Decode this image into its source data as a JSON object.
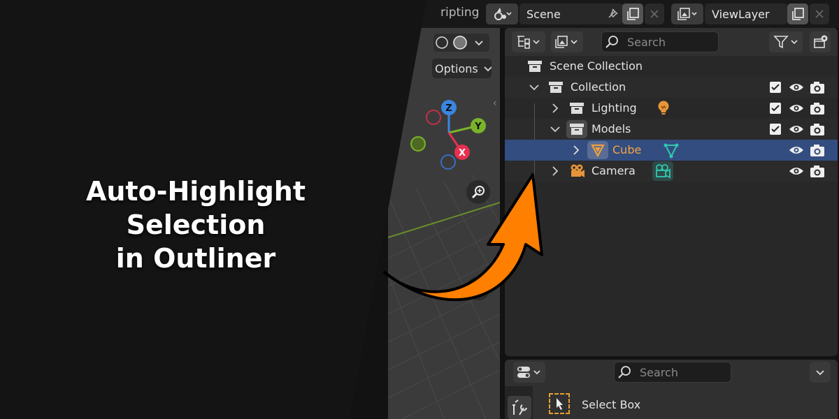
{
  "topbar": {
    "workspace_tab": "ripting",
    "scene_label": "Scene",
    "viewlayer_label": "ViewLayer"
  },
  "viewport": {
    "options_label": "Options",
    "gizmo": {
      "z": "Z",
      "y": "Y",
      "x": "X"
    }
  },
  "outliner": {
    "search_placeholder": "Search",
    "rows": [
      {
        "label": "Scene Collection"
      },
      {
        "label": "Collection"
      },
      {
        "label": "Lighting"
      },
      {
        "label": "Models"
      },
      {
        "label": "Cube"
      },
      {
        "label": "Camera"
      }
    ]
  },
  "properties": {
    "search_placeholder": "Search",
    "tool_label": "Select Box"
  },
  "overlay": {
    "title_line1": "Auto-Highlight Selection",
    "title_line2": "in Outliner"
  },
  "colors": {
    "accent_orange": "#ff7f00",
    "selection_blue": "#334d80",
    "object_orange": "#f0a040",
    "mesh_teal": "#30c8b0"
  },
  "icons": [
    "scene-icon",
    "pin-icon",
    "copy-icon",
    "close-icon",
    "render-layer-icon",
    "search-icon",
    "filter-icon",
    "new-collection-icon",
    "collection-icon",
    "checkbox-icon",
    "eye-icon",
    "camera-render-icon",
    "light-icon",
    "mesh-icon",
    "camera-data-icon",
    "zoom-icon",
    "tool-settings-icon",
    "select-box-icon"
  ]
}
